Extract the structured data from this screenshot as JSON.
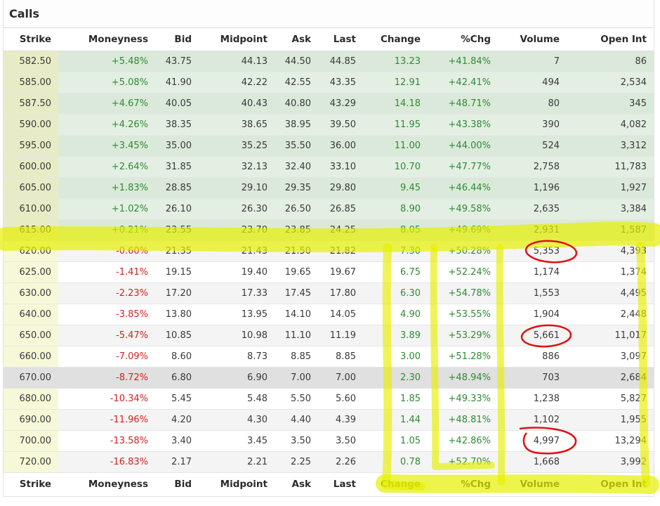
{
  "title": "Calls",
  "columns": [
    "Strike",
    "Moneyness",
    "Bid",
    "Midpoint",
    "Ask",
    "Last",
    "Change",
    "%Chg",
    "Volume",
    "Open Int"
  ],
  "rows": [
    {
      "strike": "582.50",
      "moneyness": "+5.48%",
      "bid": "43.75",
      "mid": "44.13",
      "ask": "44.50",
      "last": "44.85",
      "change": "13.23",
      "pct": "+41.84%",
      "volume": "7",
      "oi": "86",
      "itm": true
    },
    {
      "strike": "585.00",
      "moneyness": "+5.08%",
      "bid": "41.90",
      "mid": "42.22",
      "ask": "42.55",
      "last": "43.35",
      "change": "12.91",
      "pct": "+42.41%",
      "volume": "494",
      "oi": "2,534",
      "itm": true
    },
    {
      "strike": "587.50",
      "moneyness": "+4.67%",
      "bid": "40.05",
      "mid": "40.43",
      "ask": "40.80",
      "last": "43.29",
      "change": "14.18",
      "pct": "+48.71%",
      "volume": "80",
      "oi": "345",
      "itm": true
    },
    {
      "strike": "590.00",
      "moneyness": "+4.26%",
      "bid": "38.35",
      "mid": "38.65",
      "ask": "38.95",
      "last": "39.50",
      "change": "11.95",
      "pct": "+43.38%",
      "volume": "390",
      "oi": "4,082",
      "itm": true
    },
    {
      "strike": "595.00",
      "moneyness": "+3.45%",
      "bid": "35.00",
      "mid": "35.25",
      "ask": "35.50",
      "last": "36.00",
      "change": "11.00",
      "pct": "+44.00%",
      "volume": "524",
      "oi": "3,312",
      "itm": true
    },
    {
      "strike": "600.00",
      "moneyness": "+2.64%",
      "bid": "31.85",
      "mid": "32.13",
      "ask": "32.40",
      "last": "33.10",
      "change": "10.70",
      "pct": "+47.77%",
      "volume": "2,758",
      "oi": "11,783",
      "itm": true
    },
    {
      "strike": "605.00",
      "moneyness": "+1.83%",
      "bid": "28.85",
      "mid": "29.10",
      "ask": "29.35",
      "last": "29.80",
      "change": "9.45",
      "pct": "+46.44%",
      "volume": "1,196",
      "oi": "1,927",
      "itm": true
    },
    {
      "strike": "610.00",
      "moneyness": "+1.02%",
      "bid": "26.10",
      "mid": "26.30",
      "ask": "26.50",
      "last": "26.85",
      "change": "8.90",
      "pct": "+49.58%",
      "volume": "2,635",
      "oi": "3,384",
      "itm": true
    },
    {
      "strike": "615.00",
      "moneyness": "+0.21%",
      "bid": "23.55",
      "mid": "23.70",
      "ask": "23.85",
      "last": "24.25",
      "change": "8.05",
      "pct": "+49.69%",
      "volume": "2,931",
      "oi": "1,587",
      "itm": true
    },
    {
      "strike": "620.00",
      "moneyness": "-0.60%",
      "bid": "21.35",
      "mid": "21.43",
      "ask": "21.50",
      "last": "21.82",
      "change": "7.30",
      "pct": "+50.28%",
      "volume": "5,353",
      "oi": "4,393",
      "itm": false
    },
    {
      "strike": "625.00",
      "moneyness": "-1.41%",
      "bid": "19.15",
      "mid": "19.40",
      "ask": "19.65",
      "last": "19.67",
      "change": "6.75",
      "pct": "+52.24%",
      "volume": "1,174",
      "oi": "1,374",
      "itm": false
    },
    {
      "strike": "630.00",
      "moneyness": "-2.23%",
      "bid": "17.20",
      "mid": "17.33",
      "ask": "17.45",
      "last": "17.80",
      "change": "6.30",
      "pct": "+54.78%",
      "volume": "1,553",
      "oi": "4,495",
      "itm": false
    },
    {
      "strike": "640.00",
      "moneyness": "-3.85%",
      "bid": "13.80",
      "mid": "13.95",
      "ask": "14.10",
      "last": "14.05",
      "change": "4.90",
      "pct": "+53.55%",
      "volume": "1,904",
      "oi": "2,448",
      "itm": false
    },
    {
      "strike": "650.00",
      "moneyness": "-5.47%",
      "bid": "10.85",
      "mid": "10.98",
      "ask": "11.10",
      "last": "11.19",
      "change": "3.89",
      "pct": "+53.29%",
      "volume": "5,661",
      "oi": "11,017",
      "itm": false
    },
    {
      "strike": "660.00",
      "moneyness": "-7.09%",
      "bid": "8.60",
      "mid": "8.73",
      "ask": "8.85",
      "last": "8.85",
      "change": "3.00",
      "pct": "+51.28%",
      "volume": "886",
      "oi": "3,097",
      "itm": false
    },
    {
      "strike": "670.00",
      "moneyness": "-8.72%",
      "bid": "6.80",
      "mid": "6.90",
      "ask": "7.00",
      "last": "7.00",
      "change": "2.30",
      "pct": "+48.94%",
      "volume": "703",
      "oi": "2,684",
      "itm": false,
      "highlight": true
    },
    {
      "strike": "680.00",
      "moneyness": "-10.34%",
      "bid": "5.45",
      "mid": "5.48",
      "ask": "5.50",
      "last": "5.60",
      "change": "1.85",
      "pct": "+49.33%",
      "volume": "1,238",
      "oi": "5,827",
      "itm": false
    },
    {
      "strike": "690.00",
      "moneyness": "-11.96%",
      "bid": "4.20",
      "mid": "4.30",
      "ask": "4.40",
      "last": "4.39",
      "change": "1.44",
      "pct": "+48.81%",
      "volume": "1,102",
      "oi": "1,955",
      "itm": false
    },
    {
      "strike": "700.00",
      "moneyness": "-13.58%",
      "bid": "3.40",
      "mid": "3.45",
      "ask": "3.50",
      "last": "3.50",
      "change": "1.05",
      "pct": "+42.86%",
      "volume": "4,997",
      "oi": "13,294",
      "itm": false
    },
    {
      "strike": "720.00",
      "moneyness": "-16.83%",
      "bid": "2.17",
      "mid": "2.21",
      "ask": "2.25",
      "last": "2.26",
      "change": "0.78",
      "pct": "+52.70%",
      "volume": "1,668",
      "oi": "3,992",
      "itm": false
    }
  ],
  "colors": {
    "positive": "#2e8b32",
    "negative": "#d32222",
    "itm_row": "#e4efe3",
    "highlighter": "#e6f000",
    "circle": "#e01010"
  }
}
